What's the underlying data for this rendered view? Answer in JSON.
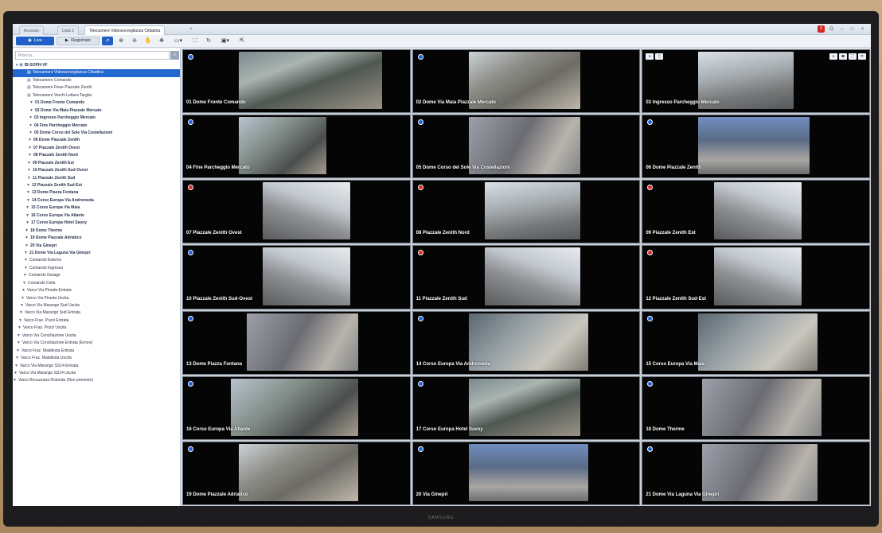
{
  "window": {
    "tabs": [
      "Accesso",
      "Lista 2",
      "Telecamere Videosorveglianza Cittadina"
    ],
    "alarm_count": "0",
    "controls": [
      "O",
      "–",
      "□",
      "×"
    ]
  },
  "toolbar": {
    "live_label": "Live",
    "recorded_label": "Registrato"
  },
  "sidebar": {
    "search_placeholder": "Ricerca...",
    "root": "IB-SOPH-VF",
    "items": [
      {
        "label": "Telecamere Videosorveglianza Cittadina",
        "kind": "view",
        "selected": true
      },
      {
        "label": "Telecamere Comando",
        "kind": "view"
      },
      {
        "label": "Telecamere Fisse Piazzale Zenith",
        "kind": "view"
      },
      {
        "label": "Telecamere Varchi Lettura Targhe",
        "kind": "view"
      },
      {
        "label": "01 Dome Fronte Comando",
        "kind": "cam"
      },
      {
        "label": "02 Dome Via Maia Piazzale Mercato",
        "kind": "cam"
      },
      {
        "label": "03 Ingresso Parcheggio Mercato",
        "kind": "cam"
      },
      {
        "label": "04 Fine Parcheggio Mercato",
        "kind": "cam"
      },
      {
        "label": "05 Dome Corso del Sole Via Costellazioni",
        "kind": "cam"
      },
      {
        "label": "06 Dome Piazzale Zenith",
        "kind": "cam"
      },
      {
        "label": "07 Piazzale Zenith Ovest",
        "kind": "cam"
      },
      {
        "label": "08 Piazzale Zenith Nord",
        "kind": "cam"
      },
      {
        "label": "09 Piazzale Zenith Est",
        "kind": "cam"
      },
      {
        "label": "10 Piazzale Zenith Sud-Ovest",
        "kind": "cam"
      },
      {
        "label": "11 Piazzale Zenith Sud",
        "kind": "cam"
      },
      {
        "label": "12 Piazzale Zenith Sud-Est",
        "kind": "cam"
      },
      {
        "label": "13 Dome Piazza Fontana",
        "kind": "cam"
      },
      {
        "label": "14 Corso Europa Via Andromeda",
        "kind": "cam"
      },
      {
        "label": "15 Corso Europa Via Maia",
        "kind": "cam"
      },
      {
        "label": "16 Corso Europa Via Atlante",
        "kind": "cam"
      },
      {
        "label": "17 Corso Europa Hotel Savoy",
        "kind": "cam"
      },
      {
        "label": "18 Dome Therme",
        "kind": "cam"
      },
      {
        "label": "19 Dome Piazzale Adriatico",
        "kind": "cam"
      },
      {
        "label": "20 Via Ginepri",
        "kind": "cam"
      },
      {
        "label": "21 Dome Via Laguna Via Ginepri",
        "kind": "cam"
      },
      {
        "label": "Comando Esterno",
        "kind": "cam-plain"
      },
      {
        "label": "Comando Ingresso",
        "kind": "cam-plain"
      },
      {
        "label": "Comando Garage",
        "kind": "cam-plain"
      },
      {
        "label": "Comando Cella",
        "kind": "cam-plain"
      },
      {
        "label": "Varco Via Pineda Entrata",
        "kind": "cam-plain"
      },
      {
        "label": "Varco Via Pineda Uscita",
        "kind": "cam-plain"
      },
      {
        "label": "Varco Via Marango Sud Uscita",
        "kind": "cam-plain"
      },
      {
        "label": "Varco Via Marango Sud Entrata",
        "kind": "cam-plain"
      },
      {
        "label": "Varco Fraz. Pozzi Entrata",
        "kind": "cam-plain"
      },
      {
        "label": "Varco Fraz. Pozzi Uscita",
        "kind": "cam-plain"
      },
      {
        "label": "Varco Via Conciliazione Uscita",
        "kind": "cam-plain"
      },
      {
        "label": "Varco Via Conciliazione Entrata (Errore)",
        "kind": "cam-plain"
      },
      {
        "label": "Varco Fraz. Malafesta Entrata",
        "kind": "cam-plain"
      },
      {
        "label": "Varco Fraz. Malafesta Uscita",
        "kind": "cam-plain"
      },
      {
        "label": "Varco Via Marango SS14 Entrata",
        "kind": "cam-plain"
      },
      {
        "label": "Varco Via Marango SS14 Uscita",
        "kind": "cam-plain"
      },
      {
        "label": "Varco Recazzana Rotonda (Non presente)",
        "kind": "cam-plain"
      }
    ]
  },
  "cameras": [
    {
      "label": "01 Dome Fronte Comando",
      "status": "blue",
      "thumb": "t1"
    },
    {
      "label": "02 Dome Via Maia Piazzale Mercato",
      "status": "blue",
      "thumb": "t2"
    },
    {
      "label": "03 Ingresso Parcheggio Mercato",
      "status": "blue",
      "thumb": "t3",
      "controls": true
    },
    {
      "label": "04 Fine Parcheggio Mercato",
      "status": "blue",
      "thumb": "t4"
    },
    {
      "label": "05 Dome Corso del Sole Via Costellazioni",
      "status": "blue",
      "thumb": "t5"
    },
    {
      "label": "06 Dome Piazzale Zenith",
      "status": "blue",
      "thumb": "t8"
    },
    {
      "label": "07 Piazzale Zenith Ovest",
      "status": "red",
      "thumb": "t6"
    },
    {
      "label": "08 Piazzale Zenith Nord",
      "status": "red",
      "thumb": "t3"
    },
    {
      "label": "09 Piazzale Zenith Est",
      "status": "red",
      "thumb": "t6"
    },
    {
      "label": "10 Piazzale Zenith Sud-Ovest",
      "status": "blue",
      "thumb": "t6"
    },
    {
      "label": "11 Piazzale Zenith Sud",
      "status": "red",
      "thumb": "t6"
    },
    {
      "label": "12 Piazzale Zenith Sud-Est",
      "status": "red",
      "thumb": "t6"
    },
    {
      "label": "13 Dome Piazza Fontana",
      "status": "blue",
      "thumb": "t5"
    },
    {
      "label": "14 Corso Europa Via Andromeda",
      "status": "blue",
      "thumb": "t7"
    },
    {
      "label": "15 Corso Europa Via Maia",
      "status": "blue",
      "thumb": "t7"
    },
    {
      "label": "16 Corso Europa Via Atlante",
      "status": "blue",
      "thumb": "t4"
    },
    {
      "label": "17 Corso Europa Hotel Savoy",
      "status": "blue",
      "thumb": "t1"
    },
    {
      "label": "18 Dome Therme",
      "status": "blue",
      "thumb": "t5"
    },
    {
      "label": "19 Dome Piazzale Adriatico",
      "status": "blue",
      "thumb": "t2"
    },
    {
      "label": "20 Via Ginepri",
      "status": "blue",
      "thumb": "t8"
    },
    {
      "label": "21 Dome Via Laguna Via Ginepri",
      "status": "blue",
      "thumb": "t5"
    }
  ],
  "grid": {
    "columns": 3,
    "rows": 7
  },
  "colors": {
    "accent": "#1f5fc7",
    "status_ok": "#1d5de4",
    "status_alarm": "#e0281e"
  },
  "brand": "SAMSUNG"
}
